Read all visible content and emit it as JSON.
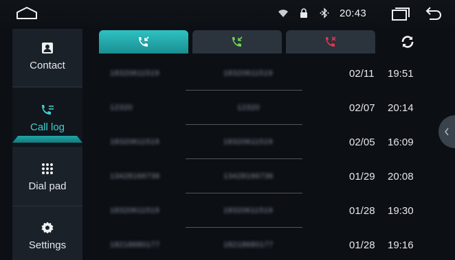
{
  "status_bar": {
    "time": "20:43",
    "icons": [
      "home-icon",
      "wifi-icon",
      "lock-icon",
      "bluetooth-icon",
      "recent-apps-icon",
      "back-icon"
    ]
  },
  "sidebar": {
    "items": [
      {
        "label": "Contact",
        "icon": "contact-icon"
      },
      {
        "label": "Call log",
        "icon": "call-log-icon",
        "active": true
      },
      {
        "label": "Dial pad",
        "icon": "dial-pad-icon"
      },
      {
        "label": "Settings",
        "icon": "settings-icon"
      }
    ]
  },
  "tabs": [
    {
      "icon": "incoming-call-icon",
      "color": "#ffffff",
      "active": true
    },
    {
      "icon": "missed-call-icon",
      "color": "#6fd35a"
    },
    {
      "icon": "rejected-call-icon",
      "color": "#e2364f"
    }
  ],
  "accent_color": "#2ec1c1",
  "call_log": [
    {
      "name": "18320611519",
      "number": "18320611519",
      "date": "02/11",
      "time": "19:51"
    },
    {
      "name": "12320",
      "number": "12320",
      "date": "02/07",
      "time": "20:14"
    },
    {
      "name": "18320611519",
      "number": "18320611519",
      "date": "02/05",
      "time": "16:09"
    },
    {
      "name": "13428166736",
      "number": "13428166736",
      "date": "01/29",
      "time": "20:08"
    },
    {
      "name": "18320611519",
      "number": "18320611519",
      "date": "01/28",
      "time": "19:30"
    },
    {
      "name": "18218680177",
      "number": "18218680177",
      "date": "01/28",
      "time": "19:16"
    }
  ]
}
